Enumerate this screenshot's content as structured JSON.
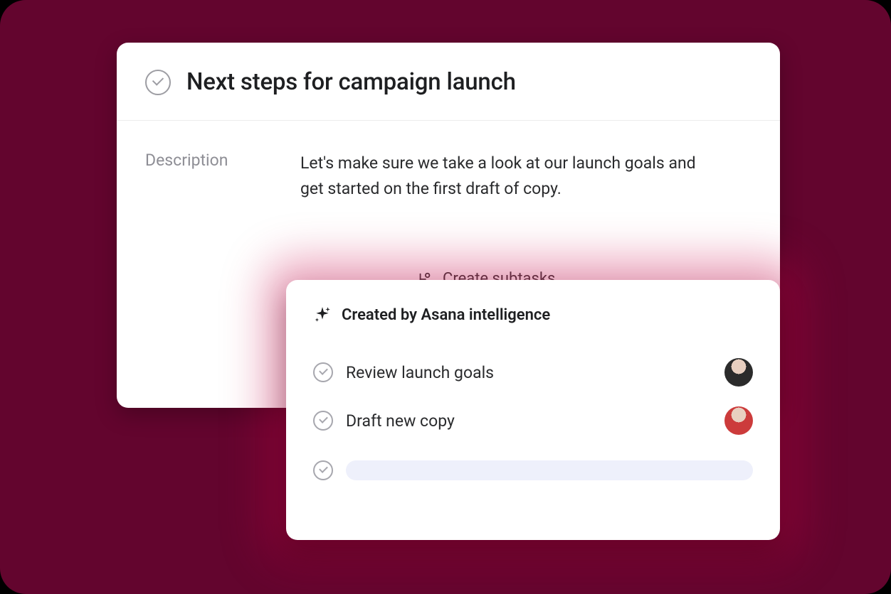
{
  "task": {
    "title": "Next steps for campaign launch",
    "description_label": "Description",
    "description_text": "Let's make sure we take a look at our launch goals and get started on the first draft of copy.",
    "create_subtasks_label": "Create subtasks"
  },
  "ai_panel": {
    "heading": "Created by Asana intelligence",
    "subtasks": [
      {
        "title": "Review launch goals"
      },
      {
        "title": "Draft new copy"
      }
    ]
  }
}
